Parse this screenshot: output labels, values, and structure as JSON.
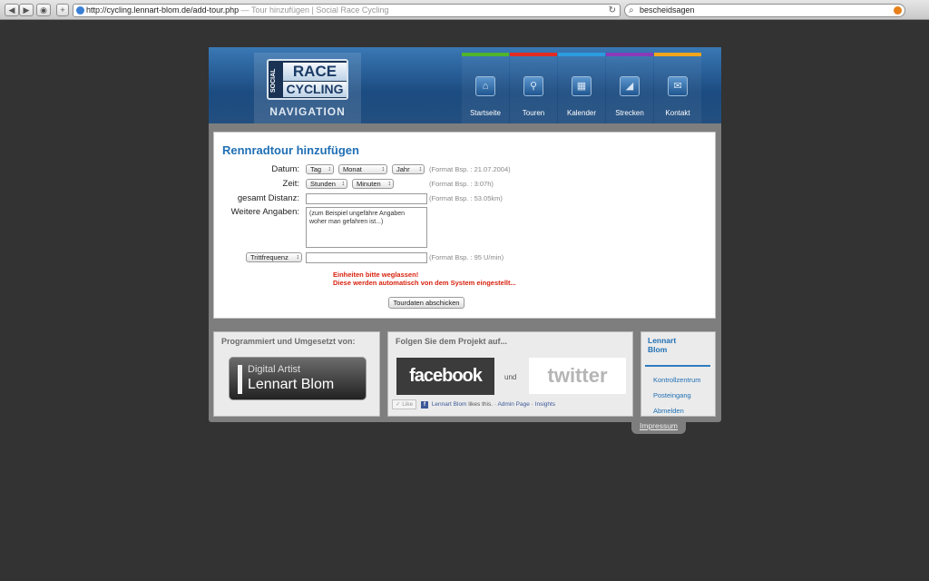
{
  "browser": {
    "back": "◀",
    "forward": "▶",
    "add_tab": "+",
    "url": "http://cycling.lennart-blom.de/add-tour.php",
    "separator": " — ",
    "page_title": "Tour hinzufügen | Social Race Cycling",
    "reload": "↻",
    "search_icon": "🔍",
    "search_value": "bescheidsagen"
  },
  "logo": {
    "social": "SOCIAL",
    "race": "RACE",
    "cycling": "CYCLING",
    "navigation": "NAVIGATION"
  },
  "nav": {
    "items": [
      {
        "label": "Startseite",
        "color": "#4fb52b",
        "icon": "home-icon",
        "glyph": "⌂"
      },
      {
        "label": "Touren",
        "color": "#e42b21",
        "icon": "bike-icon",
        "glyph": "⚲"
      },
      {
        "label": "Kalender",
        "color": "#2c9ce0",
        "icon": "calendar-icon",
        "glyph": "▦"
      },
      {
        "label": "Strecken",
        "color": "#8b3bb8",
        "icon": "route-icon",
        "glyph": "◢"
      },
      {
        "label": "Kontakt",
        "color": "#f0a51c",
        "icon": "mail-icon",
        "glyph": "✉"
      }
    ]
  },
  "form": {
    "title": "Rennradtour hinzufügen",
    "datum_label": "Datum:",
    "tag": "Tag",
    "monat": "Monat",
    "jahr": "Jahr",
    "datum_hint": "(Format Bsp. : 21.07.2004)",
    "zeit_label": "Zeit:",
    "stunden": "Stunden",
    "minuten": "Minuten",
    "zeit_hint": "(Format Bsp. : 3:07h)",
    "distanz_label": "gesamt Distanz:",
    "distanz_value": "",
    "distanz_hint": "(Format Bsp. : 53.05km)",
    "angaben_label": "Weitere Angaben:",
    "angaben_placeholder": "(zum Beispiel ungefähre Angaben woher man gefahren ist...)",
    "tritt_select": "Trittfrequenz",
    "tritt_value": "",
    "tritt_hint": "(Format Bsp. : 95 U/min)",
    "error_line1": "Einheiten bitte weglassen!",
    "error_line2": "Diese werden automatisch von dem System eingestellt...",
    "submit_label": "Tourdaten abschicken"
  },
  "footer": {
    "programmed_title": "Programmiert und Umgesetzt von:",
    "da_top": "Digital Artist",
    "da_bottom": "Lennart Blom",
    "follow_title": "Folgen Sie dem Projekt auf...",
    "facebook": "facebook",
    "und": "und",
    "twitter": "twitter",
    "like_button": "✓ Like",
    "like_text_name": "Lennart Blom",
    "like_text_rest": " likes this.",
    "like_sep": " · ",
    "admin_page": "Admin Page",
    "insights": "Insights",
    "user_title": "Lennart Blom",
    "links": [
      "Kontrollzentrum",
      "Posteingang",
      "Abmelden"
    ],
    "impressum": "Impressum"
  }
}
